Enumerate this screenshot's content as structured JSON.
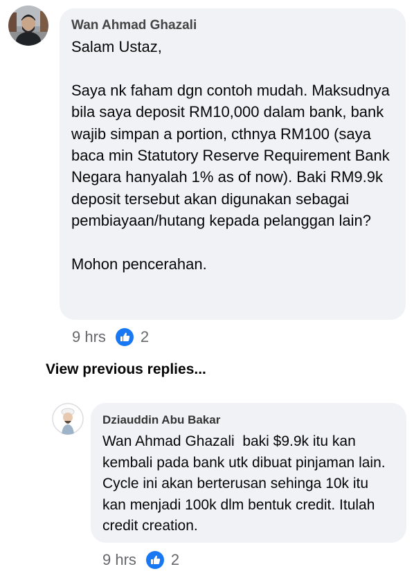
{
  "comments": [
    {
      "author": "Wan Ahmad Ghazali",
      "text": "Salam Ustaz,\n\nSaya nk faham dgn contoh mudah. Maksudnya bila saya deposit RM10,000 dalam bank, bank wajib simpan a portion, cthnya RM100 (saya baca min Statutory Reserve Requirement Bank Negara hanyalah 1% as of now). Baki RM9.9k deposit tersebut akan digunakan sebagai pembiayaan/hutang kepada pelanggan lain?\n\nMohon pencerahan.",
      "time": "9 hrs",
      "reaction_count": "2",
      "reaction_icon": "like-icon"
    },
    {
      "author": "Dziauddin Abu Bakar",
      "text": "Wan Ahmad Ghazali  baki $9.9k itu kan kembali pada bank utk dibuat pinjaman lain. Cycle ini akan berterusan sehinga 10k itu kan menjadi 100k dlm bentuk credit. Itulah credit creation.",
      "time": "9 hrs",
      "reaction_count": "2",
      "reaction_icon": "like-icon"
    }
  ],
  "view_previous_replies": "View previous replies...",
  "colors": {
    "bubble_bg": "#f0f2f5",
    "like_blue": "#1877f2",
    "meta_gray": "#65676b"
  }
}
